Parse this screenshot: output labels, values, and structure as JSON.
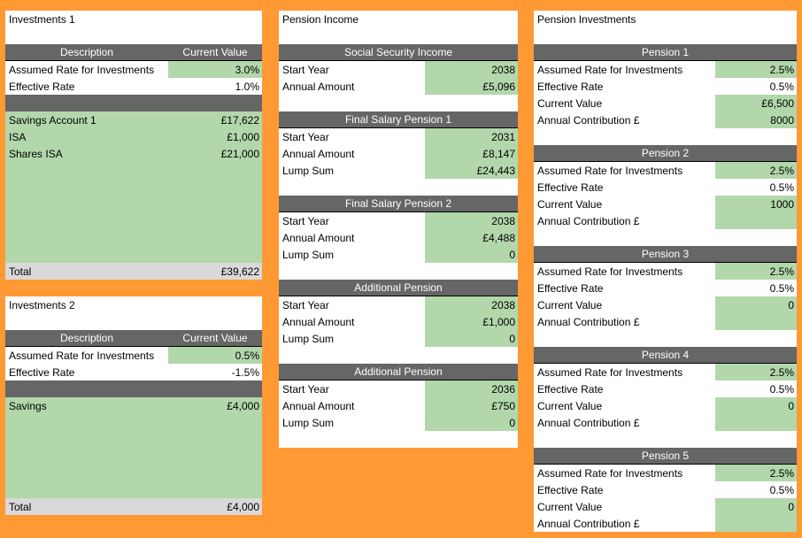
{
  "colors": {
    "background": "#FF9933",
    "input_green": "#B2D7AB",
    "header_grey": "#666666",
    "total_grey": "#D9D9D9"
  },
  "investments1": {
    "title": "Investments 1",
    "header": {
      "description": "Description",
      "value": "Current Value"
    },
    "assumed_rate": {
      "label": "Assumed Rate for Investments",
      "value": "3.0%"
    },
    "effective_rate": {
      "label": "Effective Rate",
      "value": "1.0%"
    },
    "items": [
      {
        "label": "Savings Account 1",
        "value": "£17,622"
      },
      {
        "label": "ISA",
        "value": "£1,000"
      },
      {
        "label": "Shares ISA",
        "value": "£21,000"
      }
    ],
    "total": {
      "label": "Total",
      "value": "£39,622"
    }
  },
  "investments2": {
    "title": "Investments 2",
    "header": {
      "description": "Description",
      "value": "Current Value"
    },
    "assumed_rate": {
      "label": "Assumed Rate for Investments",
      "value": "0.5%"
    },
    "effective_rate": {
      "label": "Effective Rate",
      "value": "-1.5%"
    },
    "items": [
      {
        "label": "Savings",
        "value": "£4,000"
      }
    ],
    "total": {
      "label": "Total",
      "value": "£4,000"
    }
  },
  "pension_income": {
    "title": "Pension Income",
    "sections": [
      {
        "title": "Social Security Income",
        "rows": [
          {
            "label": "Start Year",
            "value": "2038"
          },
          {
            "label": "Annual Amount",
            "value": "£5,096"
          }
        ]
      },
      {
        "title": "Final Salary Pension 1",
        "rows": [
          {
            "label": "Start Year",
            "value": "2031"
          },
          {
            "label": "Annual Amount",
            "value": "£8,147"
          },
          {
            "label": "Lump Sum",
            "value": "£24,443"
          }
        ]
      },
      {
        "title": "Final Salary Pension 2",
        "rows": [
          {
            "label": "Start Year",
            "value": "2038"
          },
          {
            "label": "Annual Amount",
            "value": "£4,488"
          },
          {
            "label": "Lump Sum",
            "value": "0"
          }
        ]
      },
      {
        "title": "Additional Pension",
        "rows": [
          {
            "label": "Start Year",
            "value": "2038"
          },
          {
            "label": "Annual Amount",
            "value": "£1,000"
          },
          {
            "label": "Lump Sum",
            "value": "0"
          }
        ]
      },
      {
        "title": "Additional Pension",
        "rows": [
          {
            "label": "Start Year",
            "value": "2036"
          },
          {
            "label": "Annual Amount",
            "value": "£750"
          },
          {
            "label": "Lump Sum",
            "value": "0"
          }
        ]
      }
    ]
  },
  "pension_investments": {
    "title": "Pension Investments",
    "pensions": [
      {
        "title": "Pension 1",
        "assumed_label": "Assumed Rate for Investments",
        "assumed": "2.5%",
        "effective_label": "Effective Rate",
        "effective": "0.5%",
        "current_label": "Current Value",
        "current": "£6,500",
        "contribution_label": "Annual Contribution £",
        "contribution": "8000"
      },
      {
        "title": "Pension 2",
        "assumed_label": "Assumed Rate for Investments",
        "assumed": "2.5%",
        "effective_label": "Effective Rate",
        "effective": "0.5%",
        "current_label": "Current Value",
        "current": "1000",
        "contribution_label": "Annual Contribution £",
        "contribution": ""
      },
      {
        "title": "Pension 3",
        "assumed_label": "Assumed Rate for Investments",
        "assumed": "2.5%",
        "effective_label": "Effective Rate",
        "effective": "0.5%",
        "current_label": "Current Value",
        "current": "0",
        "contribution_label": "Annual Contribution £",
        "contribution": ""
      },
      {
        "title": "Pension 4",
        "assumed_label": "Assumed Rate for Investments",
        "assumed": "2.5%",
        "effective_label": "Effective Rate",
        "effective": "0.5%",
        "current_label": "Current Value",
        "current": "0",
        "contribution_label": "Annual Contribution £",
        "contribution": ""
      },
      {
        "title": "Pension 5",
        "assumed_label": "Assumed Rate for Investments",
        "assumed": "2.5%",
        "effective_label": "Effective Rate",
        "effective": "0.5%",
        "current_label": "Current Value",
        "current": "0",
        "contribution_label": "Annual Contribution £",
        "contribution": ""
      }
    ]
  }
}
